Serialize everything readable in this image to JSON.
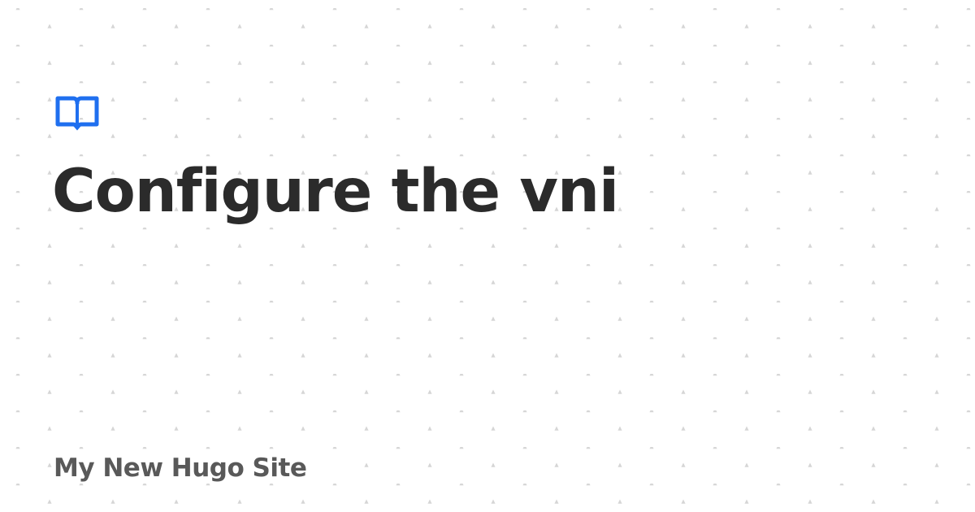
{
  "card": {
    "title": "Configure the vni",
    "site_name": "My New Hugo Site",
    "logo_icon": "open-book-icon"
  },
  "colors": {
    "background": "#ffffff",
    "pattern_dots": "#d6d6d6",
    "brand_accent": "#1f6fef",
    "title_text": "#2b2b2b",
    "site_name_text": "#595959"
  }
}
